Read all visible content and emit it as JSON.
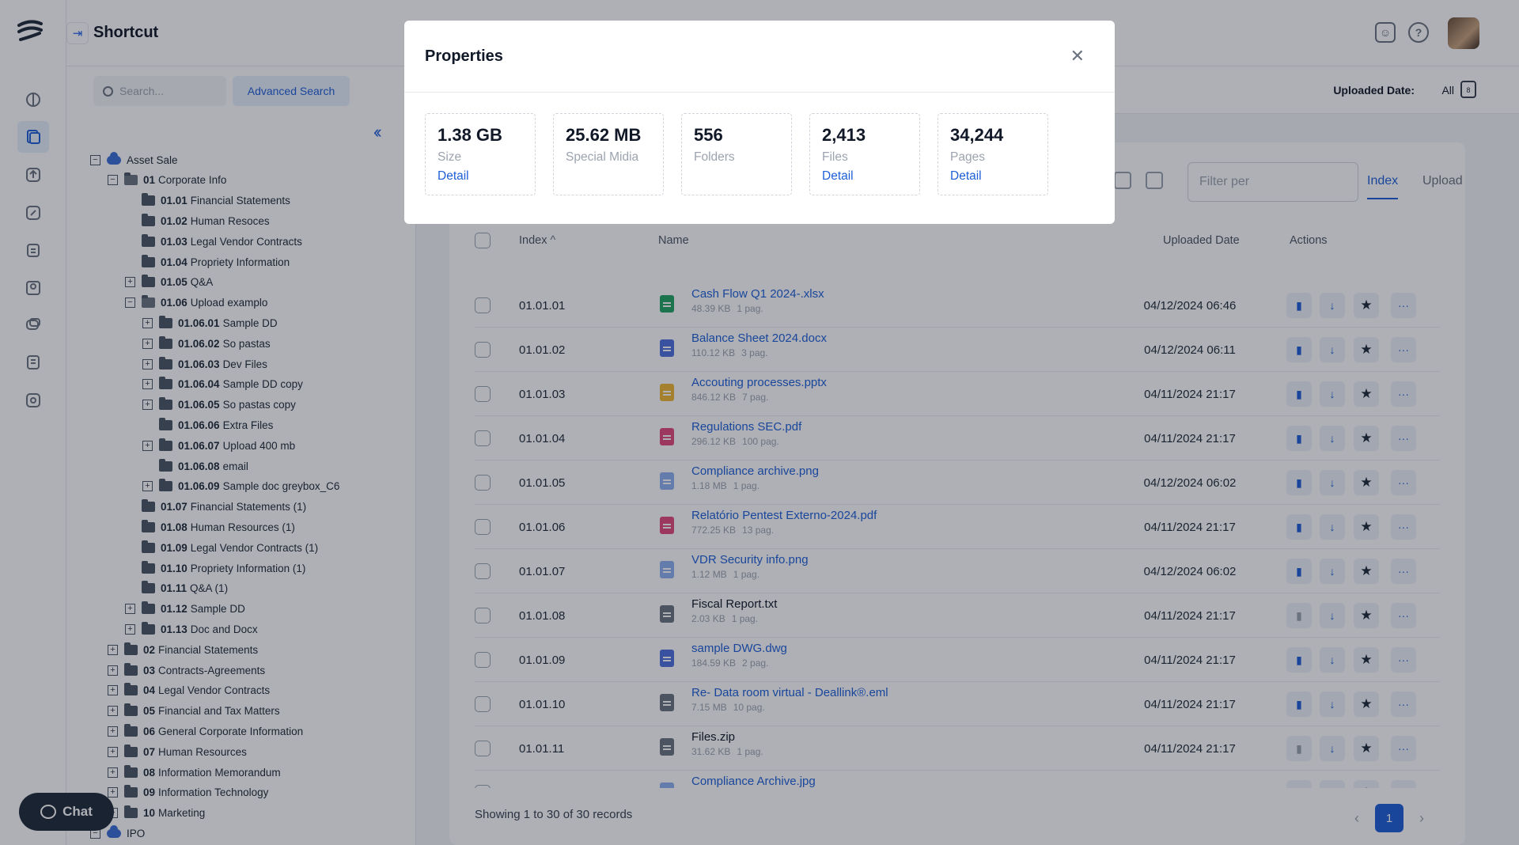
{
  "app": {
    "title": "Shortcut"
  },
  "header": {
    "icons": [
      "bot-icon",
      "help-icon"
    ]
  },
  "search": {
    "placeholder": "Search...",
    "advanced_label": "Advanced Search"
  },
  "filter": {
    "uploaded_label": "Uploaded Date:",
    "uploaded_value": "All",
    "calendar_day": "8"
  },
  "tree": [
    {
      "code": "",
      "name": "Asset Sale",
      "level": 0,
      "toggle": "−",
      "kind": "cloud"
    },
    {
      "code": "01",
      "name": "Corporate Info",
      "level": 1,
      "toggle": "−",
      "kind": "open"
    },
    {
      "code": "01.01",
      "name": "Financial Statements",
      "level": 2,
      "toggle": "",
      "kind": "folder"
    },
    {
      "code": "01.02",
      "name": "Human Resoces",
      "level": 2,
      "toggle": "",
      "kind": "folder"
    },
    {
      "code": "01.03",
      "name": "Legal Vendor Contracts",
      "level": 2,
      "toggle": "",
      "kind": "folder"
    },
    {
      "code": "01.04",
      "name": "Propriety Information",
      "level": 2,
      "toggle": "",
      "kind": "folder"
    },
    {
      "code": "01.05",
      "name": "Q&A",
      "level": 2,
      "toggle": "+",
      "kind": "folder"
    },
    {
      "code": "01.06",
      "name": "Upload examplo",
      "level": 2,
      "toggle": "−",
      "kind": "open"
    },
    {
      "code": "01.06.01",
      "name": "Sample DD",
      "level": 3,
      "toggle": "+",
      "kind": "folder"
    },
    {
      "code": "01.06.02",
      "name": "So pastas",
      "level": 3,
      "toggle": "+",
      "kind": "folder"
    },
    {
      "code": "01.06.03",
      "name": "Dev Files",
      "level": 3,
      "toggle": "+",
      "kind": "folder"
    },
    {
      "code": "01.06.04",
      "name": "Sample DD copy",
      "level": 3,
      "toggle": "+",
      "kind": "folder"
    },
    {
      "code": "01.06.05",
      "name": "So pastas copy",
      "level": 3,
      "toggle": "+",
      "kind": "folder"
    },
    {
      "code": "01.06.06",
      "name": "Extra Files",
      "level": 3,
      "toggle": "",
      "kind": "folder"
    },
    {
      "code": "01.06.07",
      "name": "Upload 400 mb",
      "level": 3,
      "toggle": "+",
      "kind": "folder"
    },
    {
      "code": "01.06.08",
      "name": "email",
      "level": 3,
      "toggle": "",
      "kind": "folder"
    },
    {
      "code": "01.06.09",
      "name": "Sample doc greybox_C6",
      "level": 3,
      "toggle": "+",
      "kind": "folder"
    },
    {
      "code": "01.07",
      "name": "Financial Statements (1)",
      "level": 2,
      "toggle": "",
      "kind": "folder"
    },
    {
      "code": "01.08",
      "name": "Human Resources (1)",
      "level": 2,
      "toggle": "",
      "kind": "folder"
    },
    {
      "code": "01.09",
      "name": "Legal Vendor Contracts (1)",
      "level": 2,
      "toggle": "",
      "kind": "folder"
    },
    {
      "code": "01.10",
      "name": "Propriety Information (1)",
      "level": 2,
      "toggle": "",
      "kind": "folder"
    },
    {
      "code": "01.11",
      "name": "Q&A (1)",
      "level": 2,
      "toggle": "",
      "kind": "folder"
    },
    {
      "code": "01.12",
      "name": "Sample DD",
      "level": 2,
      "toggle": "+",
      "kind": "folder"
    },
    {
      "code": "01.13",
      "name": "Doc and Docx",
      "level": 2,
      "toggle": "+",
      "kind": "folder"
    },
    {
      "code": "02",
      "name": "Financial Statements",
      "level": 1,
      "toggle": "+",
      "kind": "folder"
    },
    {
      "code": "03",
      "name": "Contracts-Agreements",
      "level": 1,
      "toggle": "+",
      "kind": "folder"
    },
    {
      "code": "04",
      "name": "Legal Vendor Contracts",
      "level": 1,
      "toggle": "+",
      "kind": "folder"
    },
    {
      "code": "05",
      "name": "Financial and Tax Matters",
      "level": 1,
      "toggle": "+",
      "kind": "folder"
    },
    {
      "code": "06",
      "name": "General Corporate Information",
      "level": 1,
      "toggle": "+",
      "kind": "folder"
    },
    {
      "code": "07",
      "name": "Human Resources",
      "level": 1,
      "toggle": "+",
      "kind": "folder"
    },
    {
      "code": "08",
      "name": "Information Memorandum",
      "level": 1,
      "toggle": "+",
      "kind": "folder"
    },
    {
      "code": "09",
      "name": "Information Technology",
      "level": 1,
      "toggle": "+",
      "kind": "folder"
    },
    {
      "code": "10",
      "name": "Marketing",
      "level": 1,
      "toggle": "+",
      "kind": "folder"
    },
    {
      "code": "",
      "name": "IPO",
      "level": 0,
      "toggle": "−",
      "kind": "cloud"
    }
  ],
  "main": {
    "filter_placeholder": "Filter per",
    "tabs": [
      "Index",
      "Upload"
    ],
    "columns": {
      "index": "Index",
      "name": "Name",
      "date": "Uploaded Date",
      "actions": "Actions"
    },
    "index_sort_arrow": "^",
    "rows": [
      {
        "index": "01.01.01",
        "name": "Cash Flow Q1 2024-.xlsx",
        "size": "48.39 KB",
        "pages": "1 pag.",
        "date": "04/12/2024 06:46",
        "color": "#22a565",
        "link": true
      },
      {
        "index": "01.01.02",
        "name": "Balance Sheet 2024.docx",
        "size": "110.12 KB",
        "pages": "3 pag.",
        "date": "04/12/2024 06:11",
        "color": "#4f6fe0",
        "link": true
      },
      {
        "index": "01.01.03",
        "name": "Accouting processes.pptx",
        "size": "846.12 KB",
        "pages": "7 pag.",
        "date": "04/11/2024 21:17",
        "color": "#f2b632",
        "link": true
      },
      {
        "index": "01.01.04",
        "name": "Regulations SEC.pdf",
        "size": "296.12 KB",
        "pages": "100 pag.",
        "date": "04/11/2024 21:17",
        "color": "#e44a7a",
        "link": true
      },
      {
        "index": "01.01.05",
        "name": "Compliance archive.png",
        "size": "1.18 MB",
        "pages": "1 pag.",
        "date": "04/12/2024 06:02",
        "color": "#8fb1f0",
        "link": true
      },
      {
        "index": "01.01.06",
        "name": "Relatório Pentest Externo-2024.pdf",
        "size": "772.25 KB",
        "pages": "13 pag.",
        "date": "04/11/2024 21:17",
        "color": "#e44a7a",
        "link": true
      },
      {
        "index": "01.01.07",
        "name": "VDR Security info.png",
        "size": "1.12 MB",
        "pages": "1 pag.",
        "date": "04/12/2024 06:02",
        "color": "#8fb1f0",
        "link": true
      },
      {
        "index": "01.01.08",
        "name": "Fiscal Report.txt",
        "size": "2.03 KB",
        "pages": "1 pag.",
        "date": "04/11/2024 21:17",
        "color": "#6b7280",
        "link": false
      },
      {
        "index": "01.01.09",
        "name": "sample DWG.dwg",
        "size": "184.59 KB",
        "pages": "2 pag.",
        "date": "04/11/2024 21:17",
        "color": "#4f6fe0",
        "link": true
      },
      {
        "index": "01.01.10",
        "name": "Re- Data room virtual - Deallink®.eml",
        "size": "7.15 MB",
        "pages": "10 pag.",
        "date": "04/11/2024 21:17",
        "color": "#6b7280",
        "link": true
      },
      {
        "index": "01.01.11",
        "name": "Files.zip",
        "size": "31.62 KB",
        "pages": "1 pag.",
        "date": "04/11/2024 21:17",
        "color": "#6b7280",
        "link": false
      },
      {
        "index": "",
        "name": "Compliance Archive.jpg",
        "size": "",
        "pages": "",
        "date": "",
        "color": "#8fb1f0",
        "link": true
      }
    ],
    "footer": "Showing 1 to 30 of 30 records",
    "current_page": "1"
  },
  "chat": {
    "label": "Chat"
  },
  "modal": {
    "title": "Properties",
    "stats": [
      {
        "value": "1.38 GB",
        "label": "Size",
        "detail": "Detail"
      },
      {
        "value": "25.62 MB",
        "label": "Special Midia",
        "detail": ""
      },
      {
        "value": "556",
        "label": "Folders",
        "detail": ""
      },
      {
        "value": "2,413",
        "label": "Files",
        "detail": "Detail"
      },
      {
        "value": "34,244",
        "label": "Pages",
        "detail": "Detail"
      }
    ]
  },
  "colors": {
    "accent": "#1e5fd8",
    "overlay": "rgba(17,24,39,0.34)"
  }
}
